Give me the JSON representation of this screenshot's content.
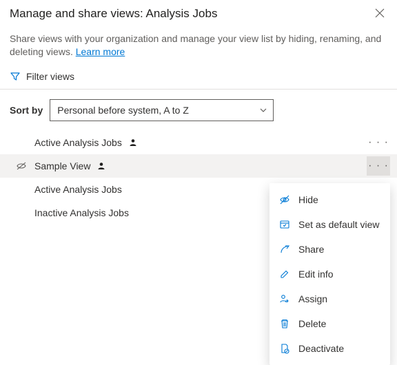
{
  "header": {
    "title": "Manage and share views: Analysis Jobs",
    "close_label": "Close"
  },
  "description": {
    "text": "Share views with your organization and manage your view list by hiding, renaming, and deleting views. ",
    "link_label": "Learn more"
  },
  "filter": {
    "label": "Filter views"
  },
  "sort": {
    "label": "Sort by",
    "selected": "Personal before system, A to Z"
  },
  "rows": [
    {
      "label": "Active Analysis Jobs",
      "personal": true,
      "hidden": false,
      "more": true,
      "selected": false
    },
    {
      "label": "Sample View",
      "personal": true,
      "hidden": true,
      "more": true,
      "selected": true
    },
    {
      "label": "Active Analysis Jobs",
      "personal": false,
      "hidden": false,
      "more": false,
      "selected": false
    },
    {
      "label": "Inactive Analysis Jobs",
      "personal": false,
      "hidden": false,
      "more": false,
      "selected": false
    }
  ],
  "menu": {
    "items": [
      {
        "icon": "hide-icon",
        "label": "Hide"
      },
      {
        "icon": "default-view-icon",
        "label": "Set as default view"
      },
      {
        "icon": "share-icon",
        "label": "Share"
      },
      {
        "icon": "edit-icon",
        "label": "Edit info"
      },
      {
        "icon": "assign-icon",
        "label": "Assign"
      },
      {
        "icon": "delete-icon",
        "label": "Delete"
      },
      {
        "icon": "deactivate-icon",
        "label": "Deactivate"
      }
    ]
  }
}
